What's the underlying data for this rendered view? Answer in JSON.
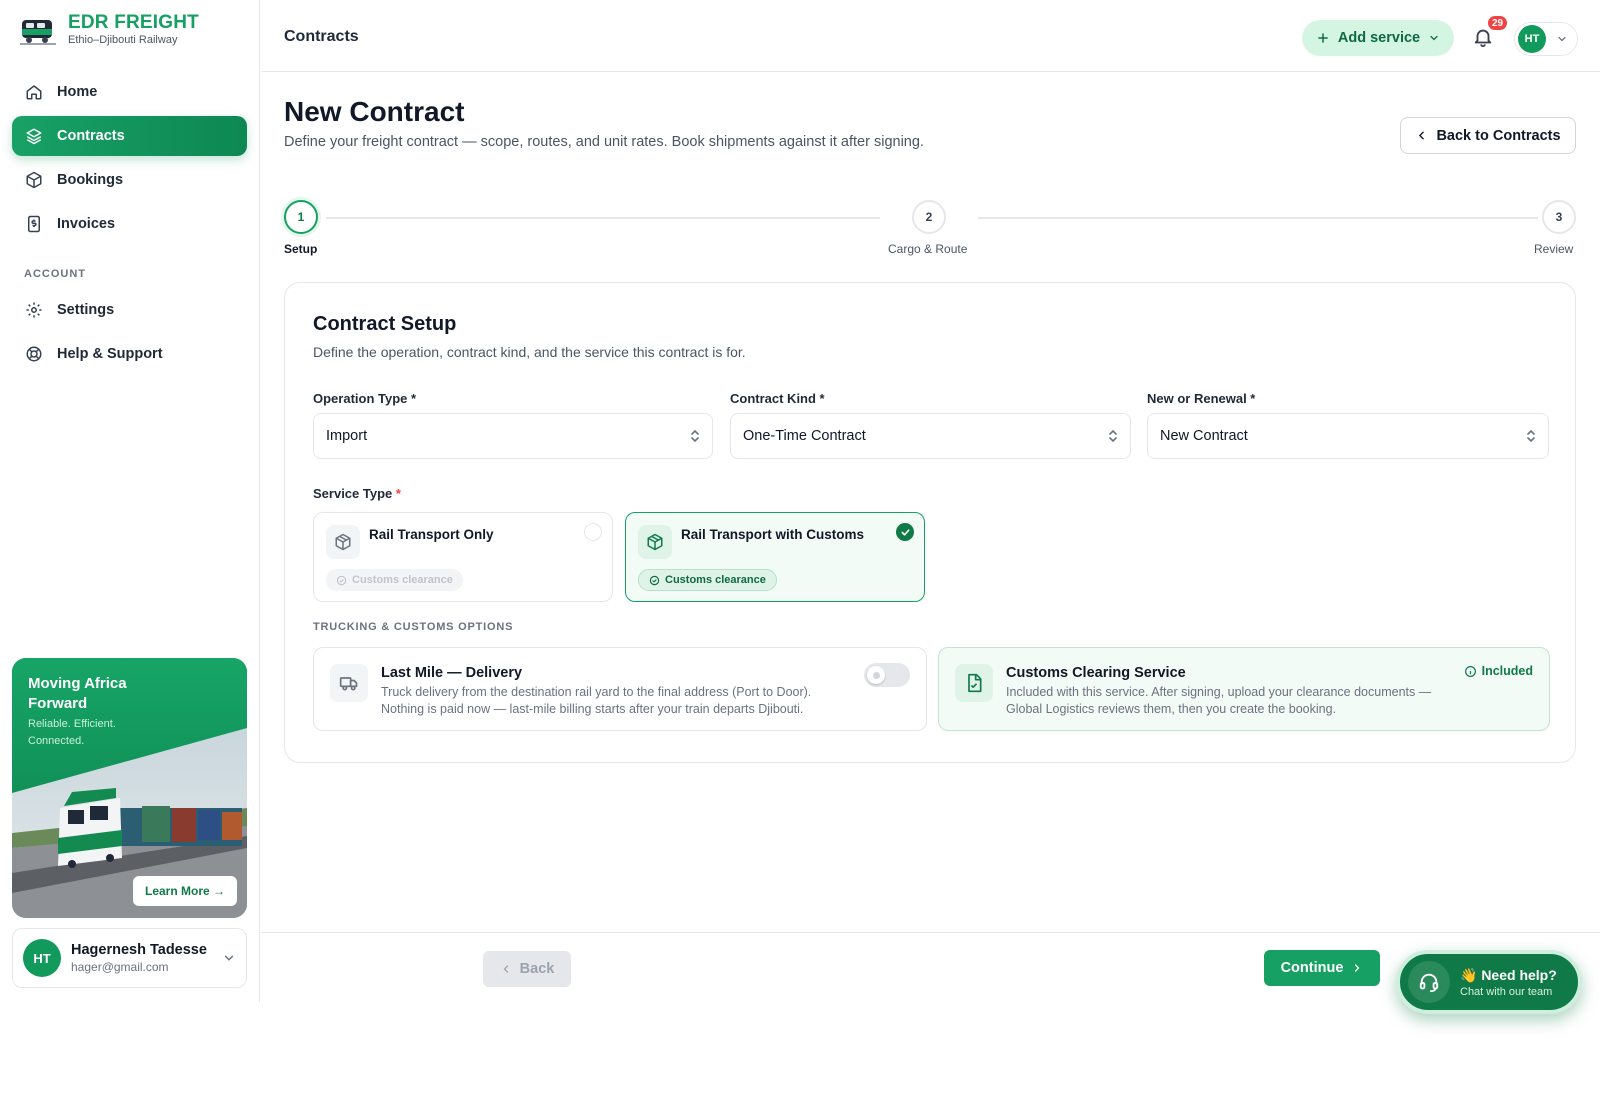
{
  "brand": {
    "name": "EDR FREIGHT",
    "subtitle": "Ethio–Djibouti Railway"
  },
  "nav": {
    "items": [
      {
        "label": "Home",
        "icon": "home-icon",
        "active": false
      },
      {
        "label": "Contracts",
        "icon": "layers-icon",
        "active": true
      },
      {
        "label": "Bookings",
        "icon": "box-icon",
        "active": false
      },
      {
        "label": "Invoices",
        "icon": "invoice-icon",
        "active": false
      }
    ],
    "account_section": "ACCOUNT",
    "account_items": [
      {
        "label": "Settings",
        "icon": "gear-icon"
      },
      {
        "label": "Help & Support",
        "icon": "lifebuoy-icon"
      }
    ]
  },
  "promo": {
    "title": "Moving Africa Forward",
    "subtitle": "Reliable. Efficient. Connected.",
    "button": "Learn More →"
  },
  "user": {
    "initials": "HT",
    "name": "Hagernesh Tadesse",
    "email": "hager@gmail.com"
  },
  "topbar": {
    "title": "Contracts",
    "add_service": "Add service",
    "notification_count": "29",
    "user_initials": "HT"
  },
  "page": {
    "title": "New Contract",
    "subtitle": "Define your freight contract — scope, routes, and unit rates. Book shipments against it after signing.",
    "back_button": "Back to Contracts"
  },
  "stepper": {
    "steps": [
      {
        "number": "1",
        "label": "Setup",
        "active": true
      },
      {
        "number": "2",
        "label": "Cargo & Route",
        "active": false
      },
      {
        "number": "3",
        "label": "Review",
        "active": false
      }
    ]
  },
  "setup": {
    "title": "Contract Setup",
    "subtitle": "Define the operation, contract kind, and the service this contract is for.",
    "fields": {
      "operation_type": {
        "label": "Operation Type *",
        "value": "Import"
      },
      "contract_kind": {
        "label": "Contract Kind *",
        "value": "One-Time Contract"
      },
      "new_or_renewal": {
        "label": "New or Renewal *",
        "value": "New Contract"
      }
    },
    "service_type_label": "Service Type",
    "service_type_required": "*",
    "services": [
      {
        "title": "Rail Transport Only",
        "chip": "Customs clearance",
        "selected": false
      },
      {
        "title": "Rail Transport with Customs",
        "chip": "Customs clearance",
        "selected": true
      }
    ],
    "options_title": "TRUCKING & CUSTOMS OPTIONS",
    "options": {
      "last_mile": {
        "title": "Last Mile — Delivery",
        "desc1": "Truck delivery from the destination rail yard to the final address (Port to Door).",
        "desc2": "Nothing is paid now — last-mile billing starts after your train departs Djibouti.",
        "enabled": false
      },
      "customs": {
        "title": "Customs Clearing Service",
        "desc1": "Included with this service. After signing, upload your clearance documents —",
        "desc2": "Global Logistics reviews them, then you create the booking.",
        "badge": "Included"
      }
    }
  },
  "footer": {
    "back": "Back",
    "continue": "Continue"
  },
  "help": {
    "title": "👋 Need help?",
    "subtitle": "Chat with our team"
  },
  "colors": {
    "accent": "#16a063",
    "accent_dark": "#0f7a47",
    "accent_light": "#d5f5e3",
    "badge": "#ef4444"
  }
}
